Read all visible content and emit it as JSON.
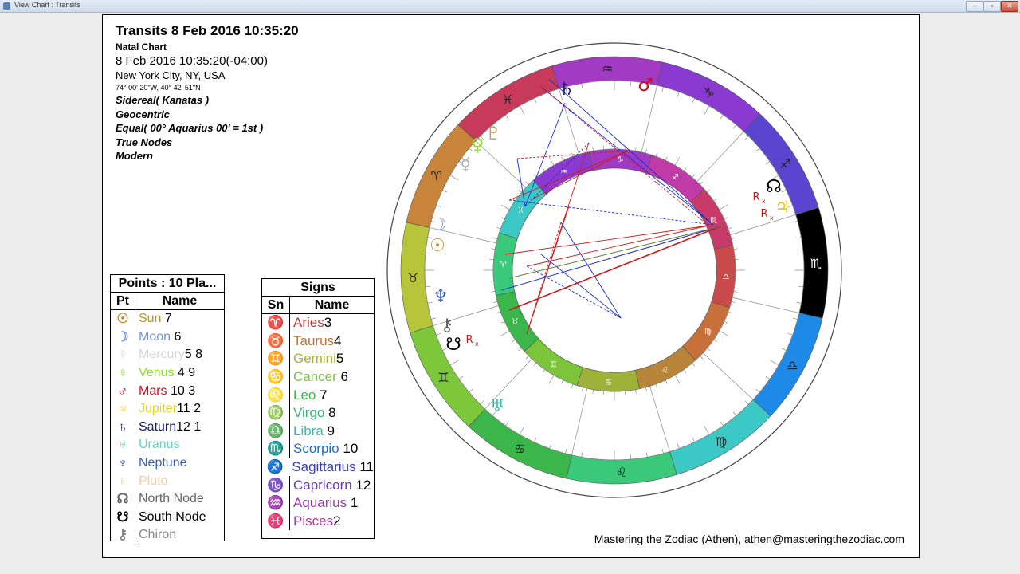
{
  "window": {
    "title": "View Chart : Transits",
    "min": "–",
    "max": "▫",
    "close": "✕"
  },
  "header": {
    "title": "Transits 8 Feb 2016 10:35:20",
    "chart_type": "Natal Chart",
    "datetime": "8 Feb 2016 10:35:20(-04:00)",
    "location": "New York City, NY, USA",
    "coords": "74° 00' 20\"W, 40° 42' 51\"N",
    "zodiac": "Sidereal( Kanatas )",
    "center": "Geocentric",
    "houses": "Equal( 00° Aquarius 00' = 1st )",
    "nodes": "True Nodes",
    "rulership": "Modern"
  },
  "points": {
    "caption": "Points : 10 Pla...",
    "col_pt": "Pt",
    "col_name": "Name",
    "rows": [
      {
        "glyph": "☉",
        "name": "Sun",
        "houses": " 7",
        "color": "#b8932e"
      },
      {
        "glyph": "☽",
        "name": "Moon",
        "houses": " 6",
        "color": "#6f94d6"
      },
      {
        "glyph": "☿",
        "name": "Mercury",
        "houses": "5 8",
        "color": "#d6d6d6"
      },
      {
        "glyph": "♀",
        "name": "Venus",
        "houses": " 4  9",
        "color": "#8fe01e"
      },
      {
        "glyph": "♂",
        "name": "Mars",
        "houses": " 10 3",
        "color": "#cc0a1e"
      },
      {
        "glyph": "♃",
        "name": "Jupiter",
        "houses": "11 2",
        "color": "#e8d21a"
      },
      {
        "glyph": "♄",
        "name": "Saturn",
        "houses": "12 1",
        "color": "#151a66"
      },
      {
        "glyph": "♅",
        "name": "Uranus",
        "houses": "",
        "color": "#5ed6c4"
      },
      {
        "glyph": "♆",
        "name": "Neptune",
        "houses": "",
        "color": "#3c5fb4"
      },
      {
        "glyph": "♇",
        "name": "Pluto",
        "houses": "",
        "color": "#f0cfa8"
      },
      {
        "glyph": "☊",
        "name": "North Node",
        "houses": "",
        "color": "#666666"
      },
      {
        "glyph": "☋",
        "name": "South Node",
        "houses": "",
        "color": "#000000"
      },
      {
        "glyph": "⚷",
        "name": "Chiron",
        "houses": "",
        "color": "#888888"
      }
    ]
  },
  "signs": {
    "caption": "Signs",
    "col_sn": "Sn",
    "col_name": "Name",
    "rows": [
      {
        "glyph": "♈",
        "name": "Aries",
        "num": "3",
        "color": "#b33a3a"
      },
      {
        "glyph": "♉",
        "name": "Taurus",
        "num": "4",
        "color": "#b8743a"
      },
      {
        "glyph": "♊",
        "name": "Gemini",
        "num": "5",
        "color": "#a6b43a"
      },
      {
        "glyph": "♋",
        "name": "Cancer",
        "num": " 6",
        "color": "#7cc43a"
      },
      {
        "glyph": "♌",
        "name": "Leo",
        "num": " 7",
        "color": "#3cb44a"
      },
      {
        "glyph": "♍",
        "name": "Virgo",
        "num": " 8",
        "color": "#32b47a"
      },
      {
        "glyph": "♎",
        "name": "Libra",
        "num": " 9",
        "color": "#3ab6b4"
      },
      {
        "glyph": "♏",
        "name": "Scorpio",
        "num": " 10",
        "color": "#1a6ec8"
      },
      {
        "glyph": "♐",
        "name": "Sagittarius",
        "num": " 11",
        "color": "#3a3ab4"
      },
      {
        "glyph": "♑",
        "name": "Capricorn",
        "num": " 12",
        "color": "#6a3ab4"
      },
      {
        "glyph": "♒",
        "name": "Aquarius",
        "num": " 1",
        "color": "#9a3ab4"
      },
      {
        "glyph": "♓",
        "name": "Pisces",
        "num": "2",
        "color": "#b43aa0"
      }
    ]
  },
  "wheel": {
    "signs_outer": [
      {
        "glyph": "♒",
        "color": "#a23ac4"
      },
      {
        "glyph": "♑",
        "color": "#8a3ad0"
      },
      {
        "glyph": "♐",
        "color": "#5a44d0"
      },
      {
        "glyph": "♏",
        "color": "#000000"
      },
      {
        "glyph": "♎",
        "color": "#1e8ae8"
      },
      {
        "glyph": "♍",
        "color": "#3cc8c4"
      },
      {
        "glyph": "♌",
        "color": "#3ac87a"
      },
      {
        "glyph": "♋",
        "color": "#3ab64a"
      },
      {
        "glyph": "♊",
        "color": "#7cc83a"
      },
      {
        "glyph": "♉",
        "color": "#b8c43a"
      },
      {
        "glyph": "♈",
        "color": "#c8843a"
      },
      {
        "glyph": "♓",
        "color": "#c83a5a"
      }
    ],
    "planets_outer": [
      {
        "glyph": "♄",
        "color": "#151a66"
      },
      {
        "glyph": "♂",
        "color": "#cc0a1e"
      },
      {
        "glyph": "♇",
        "color": "#c8a070"
      },
      {
        "glyph": "♀",
        "color": "#8fe01e"
      },
      {
        "glyph": "☿",
        "color": "#b0b0b0"
      },
      {
        "glyph": "☊",
        "color": "#000000"
      },
      {
        "glyph": "♃",
        "color": "#e8c81a"
      },
      {
        "glyph": "☽",
        "color": "#6f94d6"
      },
      {
        "glyph": "☉",
        "color": "#b8932e"
      },
      {
        "glyph": "♆",
        "color": "#3c5fb4"
      },
      {
        "glyph": "⚷",
        "color": "#555555"
      },
      {
        "glyph": "☋",
        "color": "#000000"
      },
      {
        "glyph": "♅",
        "color": "#3ab6a8"
      }
    ],
    "retro": "R",
    "retro_sub": "x"
  },
  "footer": "Mastering the Zodiac (Athen), athen@masteringthezodiac.com"
}
